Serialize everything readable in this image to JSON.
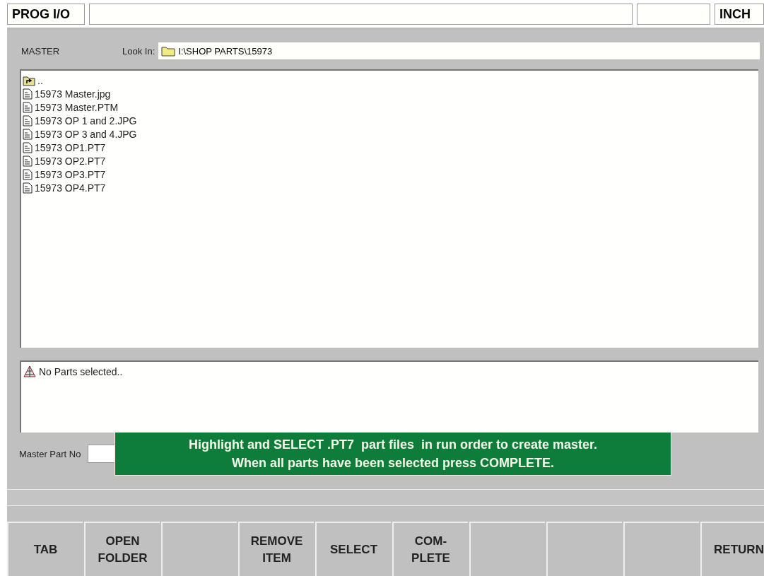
{
  "header": {
    "title": "PROG I/O",
    "unit": "INCH"
  },
  "mode": "MASTER",
  "look_in": {
    "label": "Look In:",
    "path": "I:\\SHOP PARTS\\15973"
  },
  "files": [
    {
      "kind": "up",
      "name": ".."
    },
    {
      "kind": "file",
      "name": "15973 Master.jpg"
    },
    {
      "kind": "file",
      "name": "15973 Master.PTM"
    },
    {
      "kind": "file",
      "name": "15973 OP 1 and 2.JPG"
    },
    {
      "kind": "file",
      "name": "15973 OP 3 and 4.JPG"
    },
    {
      "kind": "file",
      "name": "15973 OP1.PT7"
    },
    {
      "kind": "file",
      "name": "15973 OP2.PT7"
    },
    {
      "kind": "file",
      "name": "15973 OP3.PT7"
    },
    {
      "kind": "file",
      "name": "15973 OP4.PT7"
    }
  ],
  "selected_parts": [
    "No Parts selected.."
  ],
  "master_part_no": {
    "label": "Master Part No"
  },
  "message": [
    "Highlight and SELECT .PT7  part files  in run order to create master.",
    "When all parts have been selected press COMPLETE."
  ],
  "softkeys": [
    {
      "kind": "key",
      "label": "TAB"
    },
    {
      "kind": "key",
      "label": "OPEN\nFOLDER"
    },
    {
      "kind": "blank"
    },
    {
      "kind": "key",
      "label": "REMOVE\nITEM"
    },
    {
      "kind": "key",
      "label": "SELECT"
    },
    {
      "kind": "key",
      "label": "COM-\nPLETE"
    },
    {
      "kind": "blank"
    },
    {
      "kind": "blank"
    },
    {
      "kind": "blank"
    },
    {
      "kind": "key",
      "label": "RETURN"
    }
  ]
}
